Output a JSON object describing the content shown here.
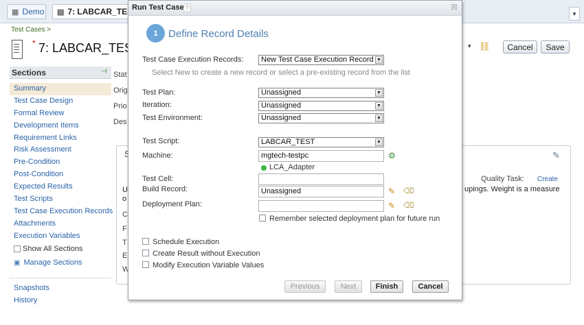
{
  "tabs": [
    {
      "label": "Demo",
      "icon": "building-icon"
    },
    {
      "label": "7: LABCAR_TESTIN",
      "icon": "document-icon"
    }
  ],
  "breadcrumb": "Test Cases >",
  "page": {
    "number_title": "7: LABCAR_TEST",
    "modified_marker": "*"
  },
  "header_buttons": {
    "cancel": "Cancel",
    "save": "Save"
  },
  "sidebar": {
    "title": "Sections",
    "items": [
      "Summary",
      "Test Case Design",
      "Formal Review",
      "Development Items",
      "Requirement Links",
      "Risk Assessment",
      "Pre-Condition",
      "Post-Condition",
      "Expected Results",
      "Test Scripts",
      "Test Case Execution Records",
      "Attachments",
      "Execution Variables"
    ],
    "show_all": "Show All Sections",
    "manage": "Manage Sections",
    "bottom": [
      "Snapshots",
      "History"
    ]
  },
  "background_labels": [
    "Stat",
    "Orig",
    "Prio",
    "Des"
  ],
  "panel": {
    "quality_task_label": "Quality Task:",
    "quality_task_link": "Create",
    "text": "upings. Weight is a measure",
    "left_fragments": [
      "U",
      "o",
      "C",
      "F",
      "T",
      "E",
      "W"
    ],
    "s_fragment": "S"
  },
  "dialog": {
    "title": "Run Test Case",
    "help": "?",
    "step_number": "1",
    "step_title": "Define Record Details",
    "fields": {
      "execution_records_label": "Test Case Execution Records:",
      "execution_records_value": "New Test Case Execution Record",
      "execution_records_hint": "Select New to create a new record or select a pre-existing record from the list",
      "test_plan_label": "Test Plan:",
      "test_plan_value": "Unassigned",
      "iteration_label": "Iteration:",
      "iteration_value": "Unassigned",
      "environment_label": "Test Environment:",
      "environment_value": "Unassigned",
      "script_label": "Test Script:",
      "script_value": "LABCAR_TEST",
      "machine_label": "Machine:",
      "machine_value": "mgtech-testpc",
      "adapter_value": "LCA_Adapter",
      "cell_label": "Test Cell:",
      "cell_value": "",
      "build_label": "Build Record:",
      "build_value": "Unassigned",
      "deployment_label": "Deployment Plan:",
      "deployment_value": "",
      "remember_label": "Remember selected deployment plan for future run"
    },
    "options": [
      "Schedule Execution",
      "Create Result without Execution",
      "Modify Execution Variable Values"
    ],
    "buttons": {
      "previous": "Previous",
      "next": "Next",
      "finish": "Finish",
      "cancel": "Cancel"
    }
  },
  "colors": {
    "accent": "#4d7fb0",
    "link": "#2a63a8",
    "step_badge": "#6aa6d8",
    "online_dot": "#3db34a"
  }
}
